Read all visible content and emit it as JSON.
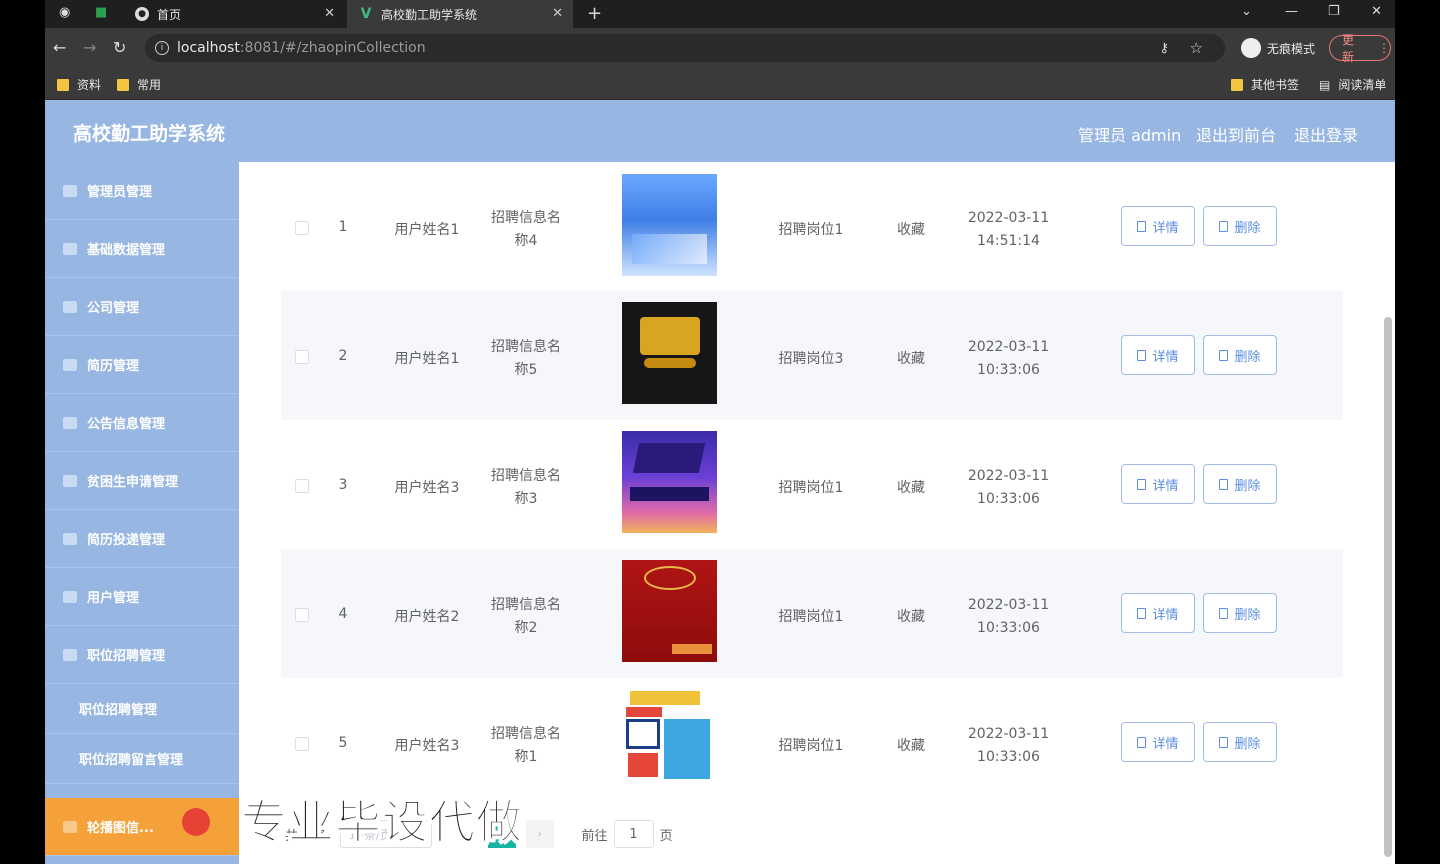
{
  "browser": {
    "tabs": [
      {
        "label": "首页"
      },
      {
        "label": "高校勤工助学系统"
      }
    ],
    "url_host": "localhost",
    "url_path": ":8081/#/zhaopinCollection",
    "incognito_label": "无痕模式",
    "update_label": "更新",
    "bookmarks": [
      "资料",
      "常用"
    ],
    "bookmarks_right": [
      "其他书签",
      "阅读清单"
    ]
  },
  "header": {
    "title": "高校勤工助学系统",
    "links": [
      "管理员 admin",
      "退出到前台",
      "退出登录"
    ]
  },
  "sidebar": {
    "items": [
      {
        "label": "管理员管理"
      },
      {
        "label": "基础数据管理"
      },
      {
        "label": "公司管理"
      },
      {
        "label": "简历管理"
      },
      {
        "label": "公告信息管理"
      },
      {
        "label": "贫困生申请管理"
      },
      {
        "label": "简历投递管理"
      },
      {
        "label": "用户管理"
      },
      {
        "label": "职位招聘管理"
      }
    ],
    "sub_items": [
      {
        "label": "职位招聘管理"
      },
      {
        "label": "职位招聘留言管理"
      }
    ],
    "active_item": {
      "label": "轮播图信..."
    }
  },
  "table": {
    "rows": [
      {
        "index": "1",
        "user": "用户姓名1",
        "title_line1": "招聘信息名",
        "title_line2": "称4",
        "position": "招聘岗位1",
        "type": "收藏",
        "date": "2022-03-11",
        "time": "14:51:14",
        "poster": "poster-blue-city"
      },
      {
        "index": "2",
        "user": "用户姓名1",
        "title_line1": "招聘信息名",
        "title_line2": "称5",
        "position": "招聘岗位3",
        "type": "收藏",
        "date": "2022-03-11",
        "time": "10:33:06",
        "poster": "poster-black-gold"
      },
      {
        "index": "3",
        "user": "用户姓名3",
        "title_line1": "招聘信息名",
        "title_line2": "称3",
        "position": "招聘岗位1",
        "type": "收藏",
        "date": "2022-03-11",
        "time": "10:33:06",
        "poster": "poster-purple-wave"
      },
      {
        "index": "4",
        "user": "用户姓名2",
        "title_line1": "招聘信息名",
        "title_line2": "称2",
        "position": "招聘岗位1",
        "type": "收藏",
        "date": "2022-03-11",
        "time": "10:33:06",
        "poster": "poster-red"
      },
      {
        "index": "5",
        "user": "用户姓名3",
        "title_line1": "招聘信息名",
        "title_line2": "称1",
        "position": "招聘岗位1",
        "type": "收藏",
        "date": "2022-03-11",
        "time": "10:33:06",
        "poster": "poster-colorful-blocks"
      }
    ],
    "detail_label": "详情",
    "delete_label": "删除"
  },
  "pagination": {
    "total_label": "共 5 条",
    "page_size_label": "10条/页",
    "current_page": "1",
    "goto_label": "前往",
    "goto_value": "1",
    "page_suffix": "页"
  },
  "watermark": "专业毕设代做",
  "colors": {
    "accent": "#97b6e2",
    "active": "#f5a13a",
    "pager": "#17b3a3",
    "button": "#5b8ee0"
  }
}
